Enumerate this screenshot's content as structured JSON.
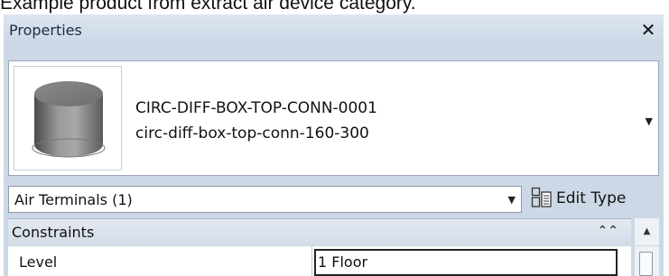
{
  "caption": "Example product from extract air device category.",
  "panel": {
    "title": "Properties",
    "close_label": "✕"
  },
  "type_selector": {
    "type_name": "CIRC-DIFF-BOX-TOP-CONN-0001",
    "family_name": "circ-diff-box-top-conn-160-300",
    "dropdown_arrow": "▼"
  },
  "filter": {
    "label": "Air Terminals (1)",
    "arrow": "▼"
  },
  "edit_type": {
    "label": "Edit Type"
  },
  "constraints": {
    "label": "Constraints",
    "collapse_icon": "⌃⌃"
  },
  "rows": {
    "level_name": "Level",
    "level_value": "1 Floor"
  },
  "scrollbar": {
    "up_arrow": "▲"
  },
  "colors": {
    "panel_bg": "#cdd8e6",
    "title_text": "#1e2d42"
  }
}
